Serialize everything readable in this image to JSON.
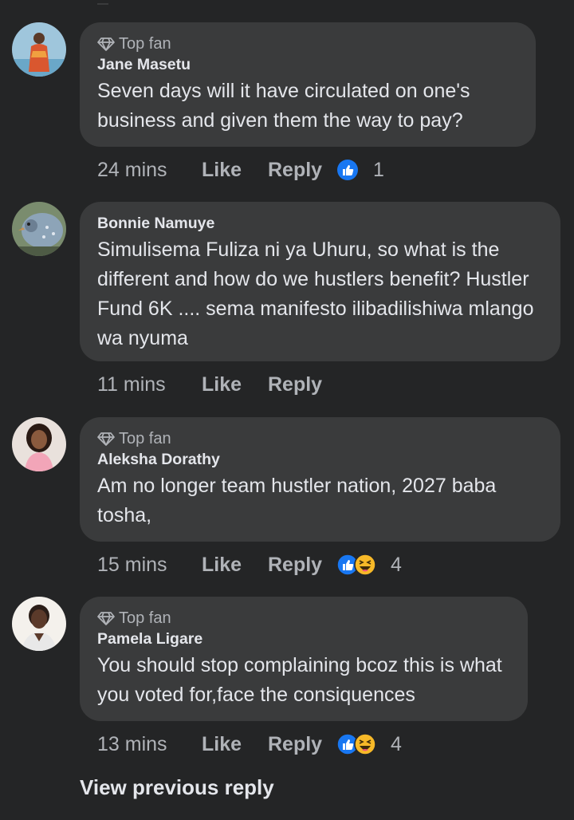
{
  "comments": [
    {
      "badge": "Top fan",
      "author": "Jane Masetu",
      "text": "Seven days will it have circulated on  one's business and given them the way to pay?",
      "time": "24 mins",
      "like": "Like",
      "reply": "Reply",
      "reactions": [
        "like-reaction-icon"
      ],
      "count": "1"
    },
    {
      "badge": "",
      "author": "Bonnie Namuye",
      "text": "Simulisema Fuliza ni ya Uhuru, so what is the different and how do we hustlers benefit? Hustler Fund 6K .... sema manifesto ilibadilishiwa mlango wa nyuma",
      "time": "11 mins",
      "like": "Like",
      "reply": "Reply",
      "reactions": [],
      "count": ""
    },
    {
      "badge": "Top fan",
      "author": "Aleksha Dorathy",
      "text": "Am no longer team hustler nation, 2027 baba tosha,",
      "time": "15 mins",
      "like": "Like",
      "reply": "Reply",
      "reactions": [
        "like-reaction-icon",
        "haha-reaction-icon"
      ],
      "count": "4"
    },
    {
      "badge": "Top fan",
      "author": "Pamela Ligare",
      "text": "You should stop complaining bcoz this is what you voted for,face the consiquences",
      "time": "13 mins",
      "like": "Like",
      "reply": "Reply",
      "reactions": [
        "like-reaction-icon",
        "haha-reaction-icon"
      ],
      "count": "4"
    }
  ],
  "view_previous_reply": "View previous reply",
  "colors": {
    "background": "#242526",
    "bubble": "#3a3b3c",
    "text": "#e4e6eb",
    "muted": "#b0b3b8",
    "like_blue": "#1877f2",
    "haha_yellow": "#f7b928"
  }
}
